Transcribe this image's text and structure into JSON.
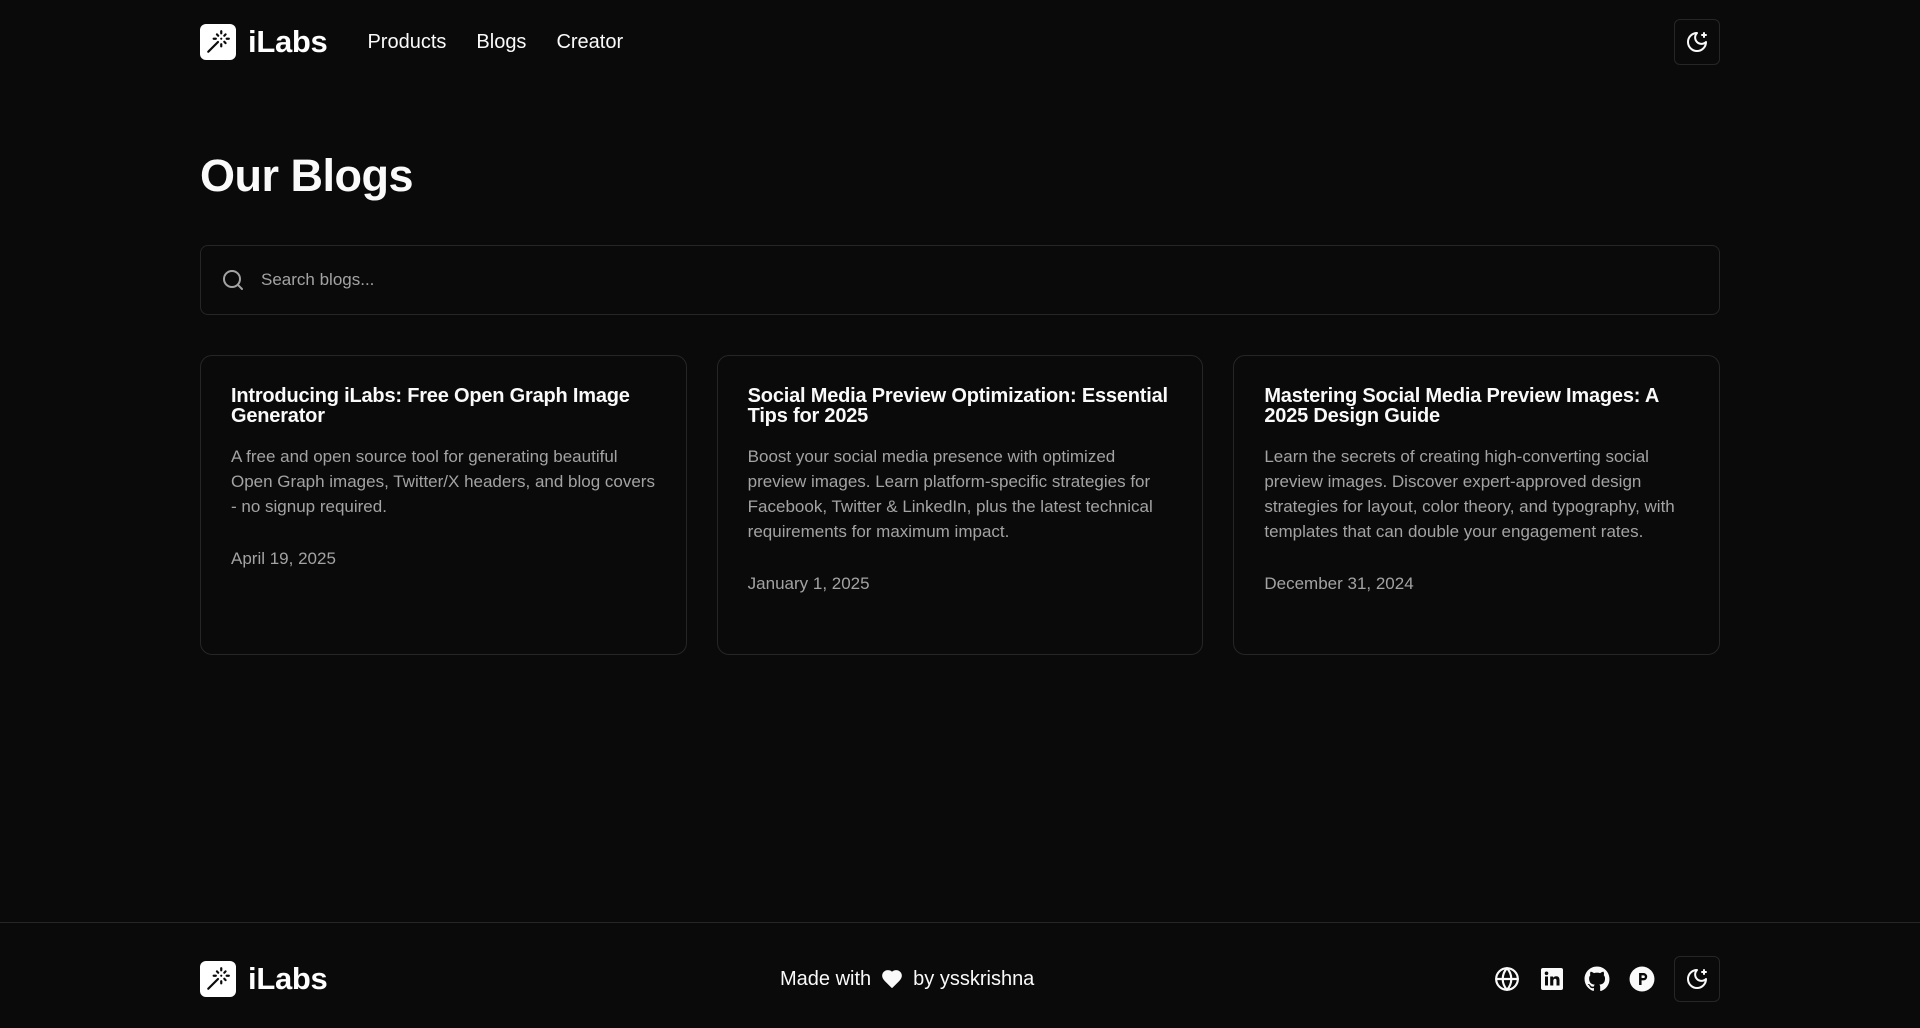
{
  "header": {
    "brand": "iLabs",
    "nav": [
      {
        "label": "Products"
      },
      {
        "label": "Blogs"
      },
      {
        "label": "Creator"
      }
    ]
  },
  "main": {
    "title": "Our Blogs",
    "search": {
      "placeholder": "Search blogs...",
      "value": ""
    },
    "posts": [
      {
        "title": "Introducing iLabs: Free Open Graph Image Generator",
        "description": "A free and open source tool for generating beautiful Open Graph images, Twitter/X headers, and blog covers - no signup required.",
        "date": "April 19, 2025"
      },
      {
        "title": "Social Media Preview Optimization: Essential Tips for 2025",
        "description": "Boost your social media presence with optimized preview images. Learn platform-specific strategies for Facebook, Twitter & LinkedIn, plus the latest technical requirements for maximum impact.",
        "date": "January 1, 2025"
      },
      {
        "title": "Mastering Social Media Preview Images: A 2025 Design Guide",
        "description": "Learn the secrets of creating high-converting social preview images. Discover expert-approved design strategies for layout, color theory, and typography, with templates that can double your engagement rates.",
        "date": "December 31, 2024"
      }
    ]
  },
  "footer": {
    "brand": "iLabs",
    "made_with_prefix": "Made with",
    "made_with_suffix": "by ysskrishna",
    "socials": [
      {
        "icon": "globe-icon"
      },
      {
        "icon": "linkedin-icon"
      },
      {
        "icon": "github-icon"
      },
      {
        "icon": "producthunt-icon"
      }
    ]
  },
  "colors": {
    "background": "#0a0a0a",
    "foreground": "#fafafa",
    "muted": "#a3a3a3",
    "border": "#262626"
  }
}
